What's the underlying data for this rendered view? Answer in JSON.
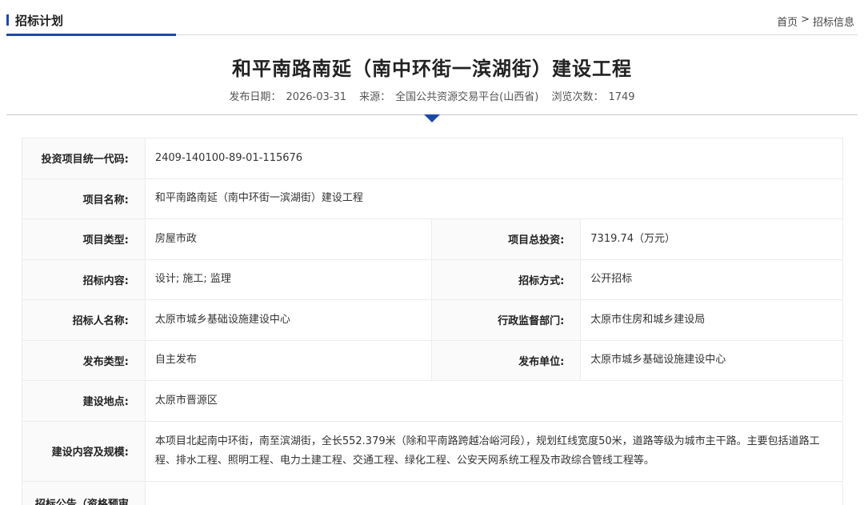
{
  "header": {
    "section_title": "招标计划",
    "breadcrumb": {
      "home": "首页",
      "separator": ">",
      "current": "招标信息"
    }
  },
  "article": {
    "title": "和平南路南延（南中环街一滨湖街）建设工程",
    "meta": {
      "publish_date_label": "发布日期：",
      "publish_date": "2026-03-31",
      "source_label": "来源：",
      "source": "全国公共资源交易平台(山西省)",
      "views_label": "浏览次数：",
      "views": "1749"
    }
  },
  "details": {
    "code_label": "投资项目统一代码:",
    "code": "2409-140100-89-01-115676",
    "name_label": "项目名称:",
    "name": "和平南路南延（南中环街一滨湖街）建设工程",
    "type_label": "项目类型:",
    "type": "房屋市政",
    "investment_label": "项目总投资:",
    "investment": "7319.74（万元）",
    "content_label": "招标内容:",
    "content": "设计; 施工; 监理",
    "method_label": "招标方式:",
    "method": "公开招标",
    "tenderer_label": "招标人名称:",
    "tenderer": "太原市城乡基础设施建设中心",
    "supervisor_label": "行政监督部门:",
    "supervisor": "太原市住房和城乡建设局",
    "pub_type_label": "发布类型:",
    "pub_type": "自主发布",
    "pub_unit_label": "发布单位:",
    "pub_unit": "太原市城乡基础设施建设中心",
    "location_label": "建设地点:",
    "location": "太原市晋源区",
    "scale_label": "建设内容及规模:",
    "scale": "本项目北起南中环街，南至滨湖街，全长552.379米（除和平南路跨越冶峪河段），规划红线宽度50米，道路等级为城市主干路。主要包括道路工程、排水工程、照明工程、电力土建工程、交通工程、绿化工程、公安天网系统工程及市政综合管线工程等。",
    "notice_label": "招标公告（资格预审"
  },
  "colors": {
    "accent": "#1d4aa3",
    "label_bg": "#fafafa",
    "border": "#ececec"
  }
}
